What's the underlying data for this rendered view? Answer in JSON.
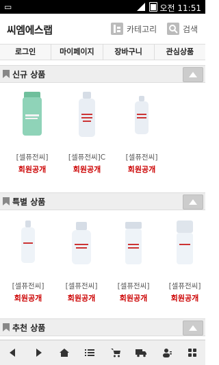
{
  "status": {
    "time": "오전 11:51"
  },
  "header": {
    "logo": "씨엠에스랩",
    "category": "카테고리",
    "search": "검색"
  },
  "nav": [
    "로그인",
    "마이페이지",
    "장바구니",
    "관심상품"
  ],
  "sections": [
    {
      "title": "신규 상품",
      "items": [
        {
          "name": "[셀퓨전씨]",
          "price": "회원공개",
          "color": "#8fd3b8"
        },
        {
          "name": "[셀퓨전씨]C",
          "price": "회원공개",
          "color": "#e9eef4"
        },
        {
          "name": "[셀퓨전씨]",
          "price": "회원공개",
          "color": "#e9eef4"
        }
      ]
    },
    {
      "title": "특별 상품",
      "items": [
        {
          "name": "[셀퓨전씨]",
          "price": "회원공개",
          "color": "#eef3f8"
        },
        {
          "name": "[셀퓨전씨]",
          "price": "회원공개",
          "color": "#eef3f8"
        },
        {
          "name": "[셀퓨전씨]",
          "price": "회원공개",
          "color": "#eef3f8"
        },
        {
          "name": "[셀퓨전씨]",
          "price": "회원공개",
          "color": "#eef3f8"
        }
      ]
    },
    {
      "title": "추천 상품",
      "items": []
    }
  ],
  "bottom_icons": [
    "back-icon",
    "forward-icon",
    "home-icon",
    "list-icon",
    "cart-icon",
    "delivery-icon",
    "user-icon",
    "grid-icon"
  ]
}
